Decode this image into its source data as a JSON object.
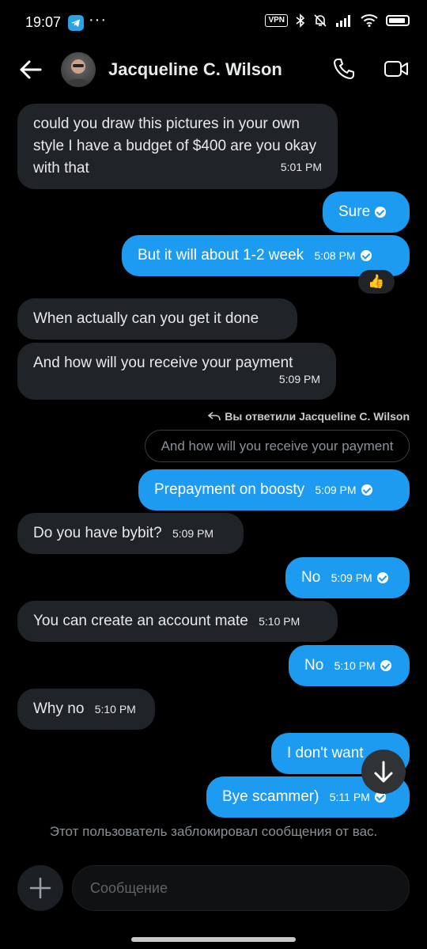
{
  "status": {
    "time": "19:07",
    "vpn": "VPN",
    "battery": "100"
  },
  "header": {
    "name": "Jacqueline C. Wilson"
  },
  "messages": [
    {
      "dir": "in",
      "text": "could you draw this pictures in your own style I have a budget of $400 are you okay with that",
      "time": "5:01 PM"
    },
    {
      "dir": "out",
      "text": "Sure",
      "time": ""
    },
    {
      "dir": "out",
      "text": "But it will about 1-2 week",
      "time": "5:08 PM",
      "reaction": "👍"
    },
    {
      "dir": "in",
      "text": "When actually can you get it done",
      "time": ""
    },
    {
      "dir": "in",
      "text": "And how will you receive your payment",
      "time": "5:09 PM"
    },
    {
      "dir": "out",
      "text": "Prepayment on boosty",
      "time": "5:09 PM"
    },
    {
      "dir": "in",
      "text": "Do you have bybit?",
      "time": "5:09 PM"
    },
    {
      "dir": "out",
      "text": "No",
      "time": "5:09 PM"
    },
    {
      "dir": "in",
      "text": "You can create an account mate",
      "time": "5:10 PM"
    },
    {
      "dir": "out",
      "text": "No",
      "time": "5:10 PM"
    },
    {
      "dir": "in",
      "text": "Why no",
      "time": "5:10 PM"
    },
    {
      "dir": "out",
      "text": "I don't want",
      "time": ""
    },
    {
      "dir": "out",
      "text": "Bye scammer)",
      "time": "5:11 PM"
    }
  ],
  "reply": {
    "note": "Вы ответили Jacqueline C. Wilson",
    "quote": "And how will you receive your payment"
  },
  "blocked_notice": "Этот пользователь заблокировал сообщения от вас.",
  "composer": {
    "placeholder": "Сообщение"
  },
  "colors": {
    "outgoing": "#1d9bf0",
    "incoming": "#202327",
    "background": "#000000"
  }
}
